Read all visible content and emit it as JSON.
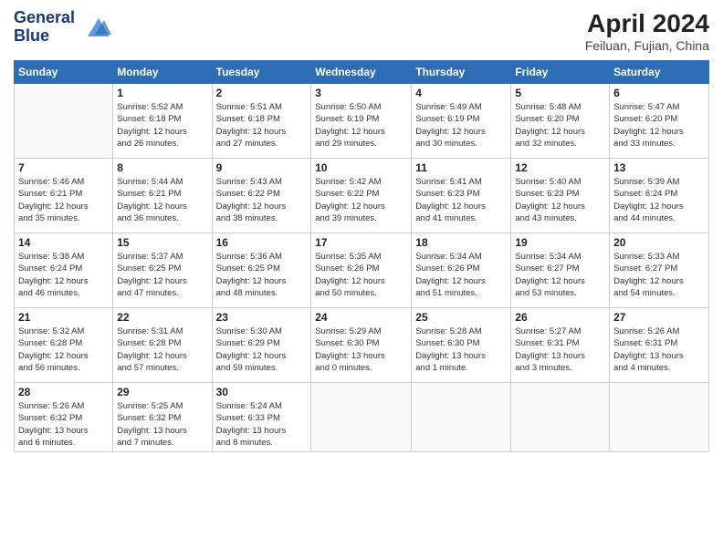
{
  "header": {
    "logo_line1": "General",
    "logo_line2": "Blue",
    "month": "April 2024",
    "location": "Feiluan, Fujian, China"
  },
  "weekdays": [
    "Sunday",
    "Monday",
    "Tuesday",
    "Wednesday",
    "Thursday",
    "Friday",
    "Saturday"
  ],
  "weeks": [
    [
      {
        "num": "",
        "info": ""
      },
      {
        "num": "1",
        "info": "Sunrise: 5:52 AM\nSunset: 6:18 PM\nDaylight: 12 hours\nand 26 minutes."
      },
      {
        "num": "2",
        "info": "Sunrise: 5:51 AM\nSunset: 6:18 PM\nDaylight: 12 hours\nand 27 minutes."
      },
      {
        "num": "3",
        "info": "Sunrise: 5:50 AM\nSunset: 6:19 PM\nDaylight: 12 hours\nand 29 minutes."
      },
      {
        "num": "4",
        "info": "Sunrise: 5:49 AM\nSunset: 6:19 PM\nDaylight: 12 hours\nand 30 minutes."
      },
      {
        "num": "5",
        "info": "Sunrise: 5:48 AM\nSunset: 6:20 PM\nDaylight: 12 hours\nand 32 minutes."
      },
      {
        "num": "6",
        "info": "Sunrise: 5:47 AM\nSunset: 6:20 PM\nDaylight: 12 hours\nand 33 minutes."
      }
    ],
    [
      {
        "num": "7",
        "info": "Sunrise: 5:46 AM\nSunset: 6:21 PM\nDaylight: 12 hours\nand 35 minutes."
      },
      {
        "num": "8",
        "info": "Sunrise: 5:44 AM\nSunset: 6:21 PM\nDaylight: 12 hours\nand 36 minutes."
      },
      {
        "num": "9",
        "info": "Sunrise: 5:43 AM\nSunset: 6:22 PM\nDaylight: 12 hours\nand 38 minutes."
      },
      {
        "num": "10",
        "info": "Sunrise: 5:42 AM\nSunset: 6:22 PM\nDaylight: 12 hours\nand 39 minutes."
      },
      {
        "num": "11",
        "info": "Sunrise: 5:41 AM\nSunset: 6:23 PM\nDaylight: 12 hours\nand 41 minutes."
      },
      {
        "num": "12",
        "info": "Sunrise: 5:40 AM\nSunset: 6:23 PM\nDaylight: 12 hours\nand 43 minutes."
      },
      {
        "num": "13",
        "info": "Sunrise: 5:39 AM\nSunset: 6:24 PM\nDaylight: 12 hours\nand 44 minutes."
      }
    ],
    [
      {
        "num": "14",
        "info": "Sunrise: 5:38 AM\nSunset: 6:24 PM\nDaylight: 12 hours\nand 46 minutes."
      },
      {
        "num": "15",
        "info": "Sunrise: 5:37 AM\nSunset: 6:25 PM\nDaylight: 12 hours\nand 47 minutes."
      },
      {
        "num": "16",
        "info": "Sunrise: 5:36 AM\nSunset: 6:25 PM\nDaylight: 12 hours\nand 48 minutes."
      },
      {
        "num": "17",
        "info": "Sunrise: 5:35 AM\nSunset: 6:26 PM\nDaylight: 12 hours\nand 50 minutes."
      },
      {
        "num": "18",
        "info": "Sunrise: 5:34 AM\nSunset: 6:26 PM\nDaylight: 12 hours\nand 51 minutes."
      },
      {
        "num": "19",
        "info": "Sunrise: 5:34 AM\nSunset: 6:27 PM\nDaylight: 12 hours\nand 53 minutes."
      },
      {
        "num": "20",
        "info": "Sunrise: 5:33 AM\nSunset: 6:27 PM\nDaylight: 12 hours\nand 54 minutes."
      }
    ],
    [
      {
        "num": "21",
        "info": "Sunrise: 5:32 AM\nSunset: 6:28 PM\nDaylight: 12 hours\nand 56 minutes."
      },
      {
        "num": "22",
        "info": "Sunrise: 5:31 AM\nSunset: 6:28 PM\nDaylight: 12 hours\nand 57 minutes."
      },
      {
        "num": "23",
        "info": "Sunrise: 5:30 AM\nSunset: 6:29 PM\nDaylight: 12 hours\nand 59 minutes."
      },
      {
        "num": "24",
        "info": "Sunrise: 5:29 AM\nSunset: 6:30 PM\nDaylight: 13 hours\nand 0 minutes."
      },
      {
        "num": "25",
        "info": "Sunrise: 5:28 AM\nSunset: 6:30 PM\nDaylight: 13 hours\nand 1 minute."
      },
      {
        "num": "26",
        "info": "Sunrise: 5:27 AM\nSunset: 6:31 PM\nDaylight: 13 hours\nand 3 minutes."
      },
      {
        "num": "27",
        "info": "Sunrise: 5:26 AM\nSunset: 6:31 PM\nDaylight: 13 hours\nand 4 minutes."
      }
    ],
    [
      {
        "num": "28",
        "info": "Sunrise: 5:26 AM\nSunset: 6:32 PM\nDaylight: 13 hours\nand 6 minutes."
      },
      {
        "num": "29",
        "info": "Sunrise: 5:25 AM\nSunset: 6:32 PM\nDaylight: 13 hours\nand 7 minutes."
      },
      {
        "num": "30",
        "info": "Sunrise: 5:24 AM\nSunset: 6:33 PM\nDaylight: 13 hours\nand 8 minutes."
      },
      {
        "num": "",
        "info": ""
      },
      {
        "num": "",
        "info": ""
      },
      {
        "num": "",
        "info": ""
      },
      {
        "num": "",
        "info": ""
      }
    ]
  ]
}
